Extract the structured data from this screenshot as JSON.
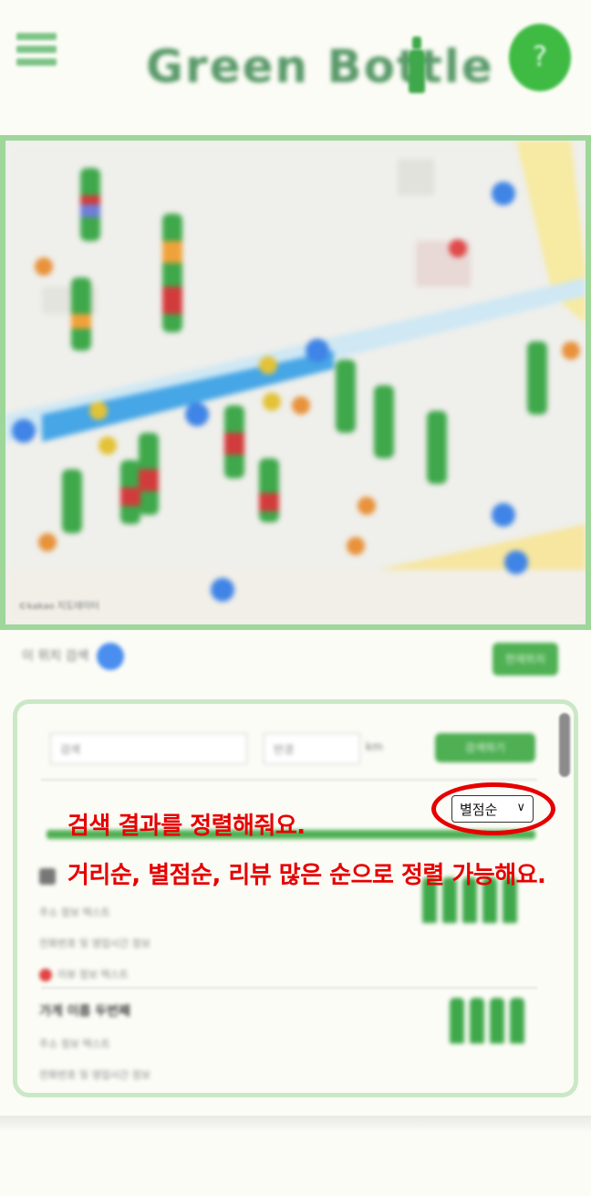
{
  "header": {
    "logo_text": "Green Bottle",
    "help_icon": "question-icon",
    "menu_icon": "hamburger-icon",
    "help_glyph": "?"
  },
  "map": {
    "attribution": "©kakao  지도데이터"
  },
  "controls": {
    "refresh_label": "이 위치 검색",
    "current_location_label": "현재위치"
  },
  "filter": {
    "search_value": "검색",
    "radius_value": "반경",
    "unit": "km",
    "search_button": "검색하기"
  },
  "sort": {
    "selected": "별점순",
    "chevron": "∨"
  },
  "results": [
    {
      "title": "가게 이름",
      "line1": "주소 정보 텍스트",
      "line2": "전화번호 및 영업시간 정보",
      "badge": "리뷰 정보 텍스트",
      "rating": 5
    },
    {
      "title": "가게 이름 두번째",
      "line1": "주소 정보 텍스트",
      "line2": "전화번호 및 영업시간 정보",
      "rating": 4
    }
  ],
  "annotations": {
    "line1": "검색 결과를 정렬해줘요.",
    "line2": "거리순, 별점순, 리뷰 많은 순으로 정렬 가능해요."
  },
  "colors": {
    "accent_green": "#3fbb44",
    "annotation_red": "#e60000"
  }
}
